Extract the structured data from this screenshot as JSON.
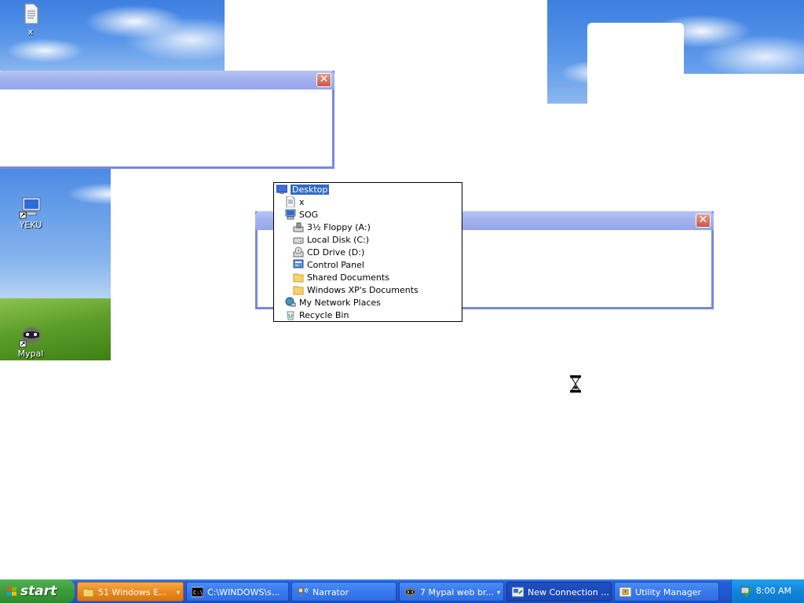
{
  "desktop": {
    "icons": [
      {
        "label": "x",
        "icon": "text-document-icon"
      },
      {
        "label": "YEKU",
        "icon": "computer-shortcut-icon"
      },
      {
        "label": "Mypal",
        "icon": "raccoon-shortcut-icon"
      }
    ]
  },
  "dialogs": [
    {
      "close_label": "✕"
    },
    {
      "close_label": "✕"
    }
  ],
  "tree": {
    "items": [
      {
        "label": "Desktop",
        "icon": "desktop-icon",
        "level": 0,
        "selected": true
      },
      {
        "label": "x",
        "icon": "document-icon",
        "level": 1
      },
      {
        "label": "SOG",
        "icon": "my-computer-icon",
        "level": 1
      },
      {
        "label": "3½ Floppy (A:)",
        "icon": "floppy-drive-icon",
        "level": 2
      },
      {
        "label": "Local Disk (C:)",
        "icon": "hard-disk-icon",
        "level": 2
      },
      {
        "label": "CD Drive (D:)",
        "icon": "cd-drive-icon",
        "level": 2
      },
      {
        "label": "Control Panel",
        "icon": "control-panel-icon",
        "level": 2
      },
      {
        "label": "Shared Documents",
        "icon": "folder-icon",
        "level": 2
      },
      {
        "label": "Windows XP's Documents",
        "icon": "folder-icon",
        "level": 2
      },
      {
        "label": "My Network Places",
        "icon": "network-places-icon",
        "level": 1
      },
      {
        "label": "Recycle Bin",
        "icon": "recycle-bin-icon",
        "level": 1
      }
    ]
  },
  "taskbar": {
    "start_label": "start",
    "tasks": [
      {
        "label": "51 Windows E...",
        "icon": "folder-icon",
        "state": "flash",
        "group_arrow": "▾"
      },
      {
        "label": "C:\\WINDOWS\\s...",
        "icon": "command-prompt-icon",
        "state": "normal"
      },
      {
        "label": "Narrator",
        "icon": "narrator-icon",
        "state": "normal"
      },
      {
        "label": "7 Mypal web br...",
        "icon": "raccoon-icon",
        "state": "normal",
        "group_arrow": "▾"
      },
      {
        "label": "New Connection ...",
        "icon": "new-connection-icon",
        "state": "active"
      },
      {
        "label": "Utility Manager",
        "icon": "utility-manager-icon",
        "state": "normal"
      }
    ],
    "tray": {
      "clock": "8:00 AM",
      "icon": "safely-remove-icon"
    }
  },
  "colors": {
    "taskbar": "#245edb",
    "start": "#3c9a3c",
    "selection": "#316ac5",
    "window_border": "#7a89d6"
  }
}
